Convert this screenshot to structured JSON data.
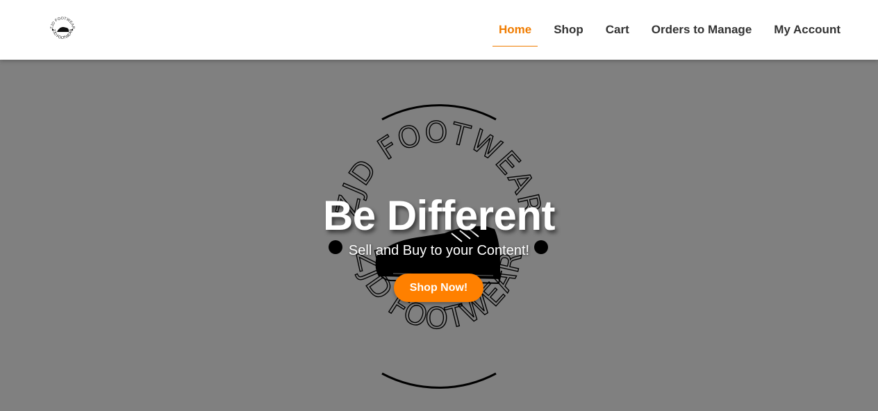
{
  "brand": {
    "logo_text": "ZJD FOOTWEAR"
  },
  "nav": {
    "items": [
      {
        "label": "Home",
        "active": true
      },
      {
        "label": "Shop",
        "active": false
      },
      {
        "label": "Cart",
        "active": false
      },
      {
        "label": "Orders to Manage",
        "active": false
      },
      {
        "label": "My Account",
        "active": false
      }
    ]
  },
  "hero": {
    "title": "Be Different",
    "subtitle": "Sell and Buy to your Content!",
    "cta_label": "Shop Now!",
    "emblem_text_top": "ZJD FOOTWEAR",
    "emblem_text_bottom": "ZJD FOOTWEAR"
  },
  "colors": {
    "accent": "#f07c00",
    "button": "#ff8000",
    "hero_background": "#808080",
    "header_background": "#ffffff",
    "nav_text": "#333333"
  }
}
